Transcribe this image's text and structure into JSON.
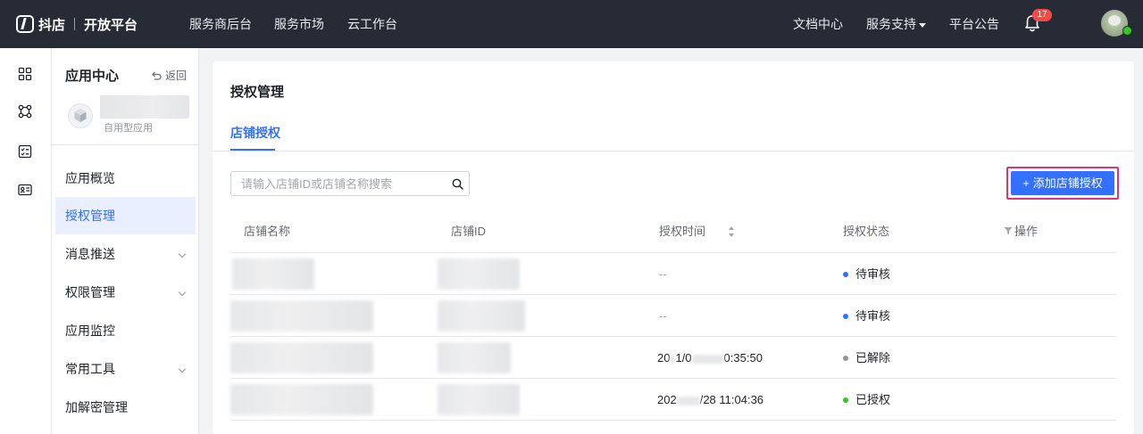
{
  "topbar": {
    "brand": "抖店",
    "product": "开放平台",
    "nav": [
      "服务商后台",
      "服务市场",
      "云工作台"
    ],
    "right_links": [
      "文档中心",
      "服务支持",
      "平台公告"
    ],
    "notification_count": "17"
  },
  "sidebar": {
    "title": "应用中心",
    "back_label": "返回",
    "app_type": "自用型应用",
    "items": [
      {
        "label": "应用概览",
        "active": false,
        "expandable": false
      },
      {
        "label": "授权管理",
        "active": true,
        "expandable": false
      },
      {
        "label": "消息推送",
        "active": false,
        "expandable": true
      },
      {
        "label": "权限管理",
        "active": false,
        "expandable": true
      },
      {
        "label": "应用监控",
        "active": false,
        "expandable": false
      },
      {
        "label": "常用工具",
        "active": false,
        "expandable": true
      },
      {
        "label": "加解密管理",
        "active": false,
        "expandable": false
      }
    ]
  },
  "main": {
    "title": "授权管理",
    "tabs": [
      {
        "label": "店铺授权",
        "active": true
      }
    ],
    "search": {
      "placeholder": "请输入店铺ID或店铺名称搜索",
      "value": ""
    },
    "add_button_label": "添加店铺授权",
    "table": {
      "columns": [
        "店铺名称",
        "店铺ID",
        "授权时间",
        "授权状态",
        "操作"
      ],
      "rows": [
        {
          "time": "--",
          "time_visible_parts": [],
          "status": "待审核",
          "status_color": "#3370ff"
        },
        {
          "time": "--",
          "time_visible_parts": [],
          "status": "待审核",
          "status_color": "#3370ff"
        },
        {
          "time": "",
          "time_visible_parts": [
            "20",
            "1/0",
            "0:35:50"
          ],
          "status": "已解除",
          "status_color": "#8f959e"
        },
        {
          "time": "",
          "time_visible_parts": [
            "202",
            "/28 11:04:36"
          ],
          "status": "已授权",
          "status_color": "#34c724"
        }
      ]
    }
  },
  "colors": {
    "accent": "#3370ff",
    "topbar_bg": "#262b35",
    "highlight_border": "#e0337a"
  }
}
